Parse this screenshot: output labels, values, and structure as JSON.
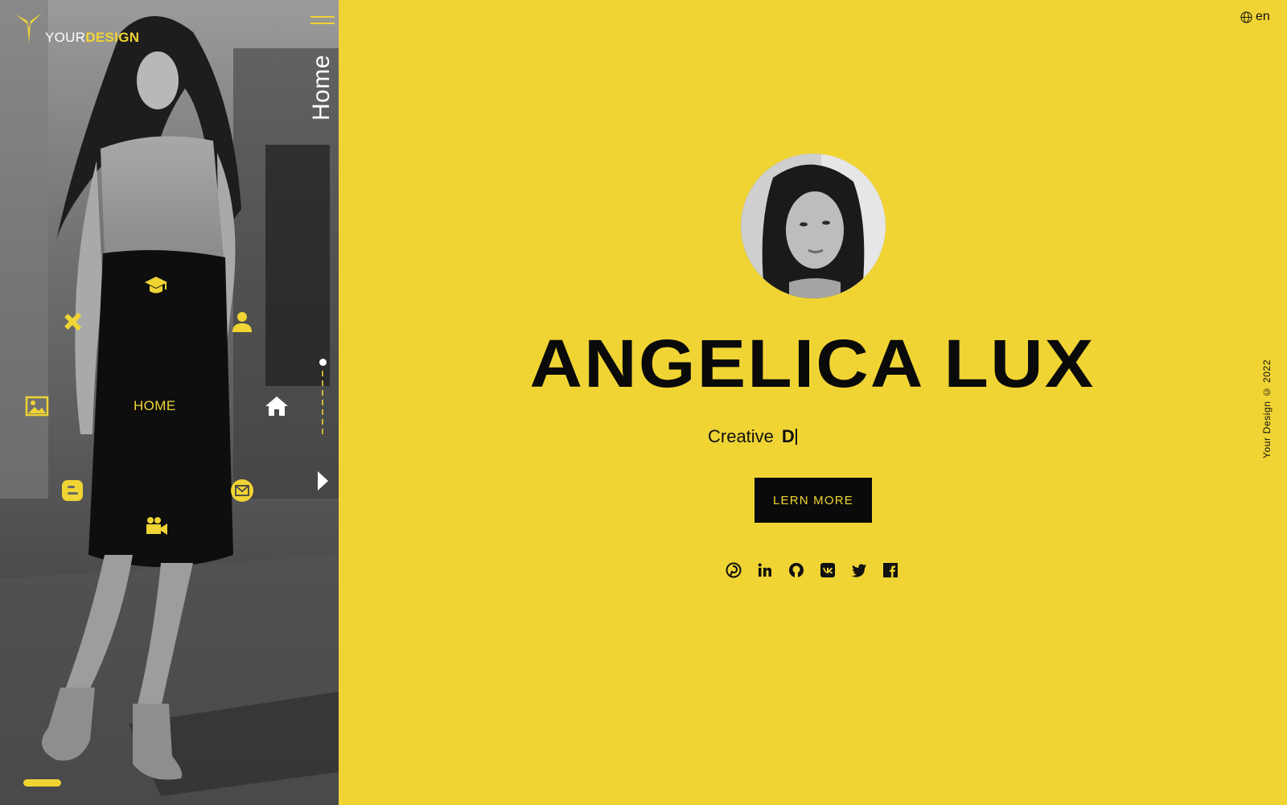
{
  "brand": {
    "prefix": "YOUR",
    "suffix": "DESIGN",
    "accent": "#f0d434"
  },
  "page_label": "Home",
  "language": {
    "code": "en",
    "icon": "globe-icon"
  },
  "copyright": "Your Design © 2022",
  "nav": {
    "home_label": "HOME",
    "icons": [
      "graduation-cap-icon",
      "tools-icon",
      "user-icon",
      "image-icon",
      "home-icon",
      "blogger-icon",
      "envelope-icon",
      "video-camera-icon"
    ]
  },
  "hero": {
    "name": "ANGELICA LUX",
    "tagline_static": "Creative",
    "tagline_typed": "D",
    "cta_label": "LERN MORE"
  },
  "socials": [
    "pinterest-icon",
    "linkedin-icon",
    "github-icon",
    "vk-icon",
    "twitter-icon",
    "facebook-icon"
  ],
  "colors": {
    "background": "#f0d434",
    "text": "#0a0a0a",
    "button": "#0a0a0a"
  }
}
